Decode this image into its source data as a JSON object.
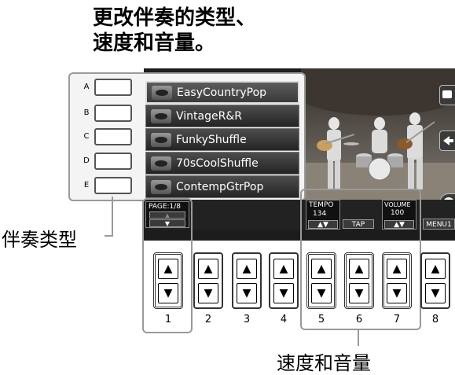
{
  "title_lines": [
    "更改伴奏的类型、",
    "速度和音量。"
  ],
  "side_buttons": [
    "A",
    "B",
    "C",
    "D",
    "E"
  ],
  "styles": [
    {
      "name": "EasyCountryPop",
      "selected": true
    },
    {
      "name": "VintageR&R",
      "selected": false
    },
    {
      "name": "FunkyShuffle",
      "selected": false
    },
    {
      "name": "70sCoolShuffle",
      "selected": false
    },
    {
      "name": "ContempGtrPop",
      "selected": false
    }
  ],
  "page": {
    "label": "PAGE:1/8",
    "up": "▲",
    "down": "▼"
  },
  "tempo": {
    "label": "TEMPO",
    "value": "134",
    "arrows": "▲▼"
  },
  "tap": "TAP",
  "volume": {
    "label": "VOLUME",
    "value": "100",
    "arrows": "▲▼"
  },
  "menu": "MENU1",
  "button_numbers": [
    "1",
    "2",
    "3",
    "4",
    "5",
    "6",
    "7",
    "8"
  ],
  "callout_style_type": "伴奏类型",
  "callout_tempo_volume": "速度和音量",
  "arrow_up": "▲",
  "arrow_down": "▼",
  "colors": {
    "screen_bg": "#1c1c1c",
    "frame": "#9a9a9a",
    "item_bg": "#3a3a3a"
  },
  "icons": [
    "piano-icon",
    "back-arrow-icon",
    "play-icon",
    "style-icon"
  ]
}
